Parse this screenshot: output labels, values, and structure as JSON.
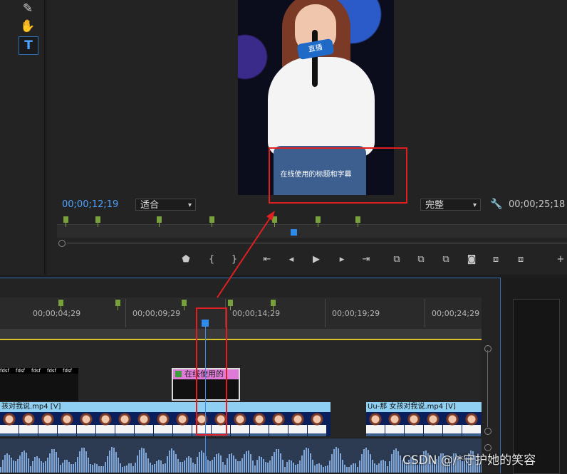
{
  "tools": {
    "pen_glyph": "✎",
    "hand_glyph": "✋",
    "type_glyph": "T"
  },
  "monitor": {
    "caption": "在线使用的标题和字幕",
    "mic_logo": "直播",
    "current_timecode": "00;00;12;19",
    "duration_timecode": "00;00;25;18",
    "fit_select": "适合",
    "quality_select": "完整",
    "accent_color": "#2d8ceb",
    "controls": [
      "marker-icon",
      "mark-in-icon",
      "mark-out-icon",
      "go-to-in-icon",
      "step-back-icon",
      "play-icon",
      "step-forward-icon",
      "go-to-out-icon",
      "insert-icon",
      "overwrite-icon",
      "lift-icon",
      "export-frame-icon",
      "compare-icon",
      "button-editor-icon",
      "add-icon"
    ],
    "control_glyphs": [
      "⬟",
      "{",
      "}",
      "⇤",
      "◂",
      "▶",
      "▸",
      "⇥",
      "⧉",
      "⧉",
      "⧉",
      "◙",
      "⧈",
      "⧈",
      "+"
    ]
  },
  "timeline": {
    "tick_labels": [
      "00;00;04;29",
      "00;00;09;29",
      "00;00;14;29",
      "00;00;19;29",
      "00;00;24;29"
    ],
    "small_clip_label": "fdsf",
    "title_clip_label": "在线使用的",
    "video_clip_left_label": "孩对我说.mp4 [V]",
    "video_clip_right_label": "Uu-那 女孩对我说.mp4 [V]",
    "fx_badge": "fx"
  },
  "watermark": "CSDN @/*守护她的笑容"
}
